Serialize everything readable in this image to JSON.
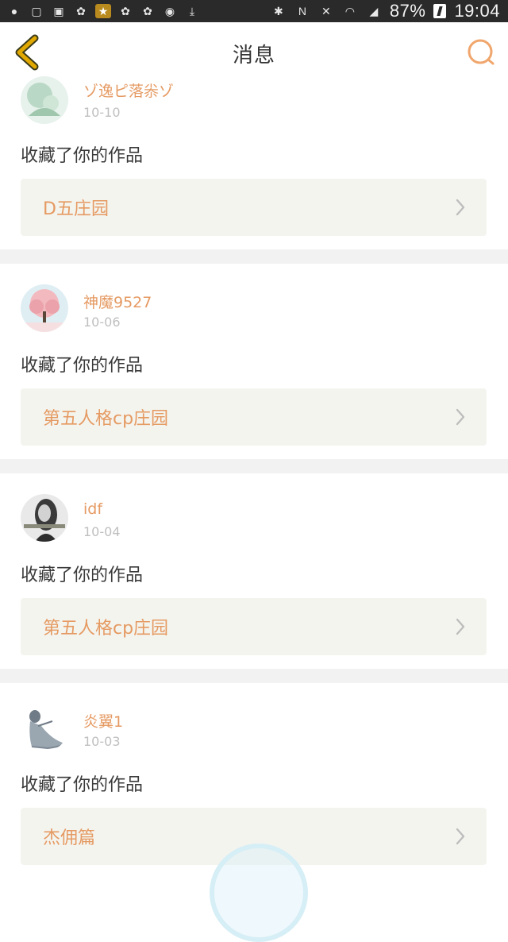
{
  "status_bar": {
    "battery": "87%",
    "time": "19:04",
    "n_mark": "N"
  },
  "header": {
    "title": "消息"
  },
  "messages": [
    {
      "user": "ゾ逸ピ落尜ゾ",
      "date": "10-10",
      "action": "收藏了你的作品",
      "work": "D五庄园"
    },
    {
      "user": "神魔9527",
      "date": "10-06",
      "action": "收藏了你的作品",
      "work": "第五人格cp庄园"
    },
    {
      "user": "idf",
      "date": "10-04",
      "action": "收藏了你的作品",
      "work": "第五人格cp庄园"
    },
    {
      "user": "炎翼1",
      "date": "10-03",
      "action": "收藏了你的作品",
      "work": "杰佣篇"
    }
  ],
  "colors": {
    "accent": "#e59a62",
    "back_icon": "#e0a800",
    "card_bg": "#f4f4ef",
    "separator": "#f2f2f2"
  }
}
